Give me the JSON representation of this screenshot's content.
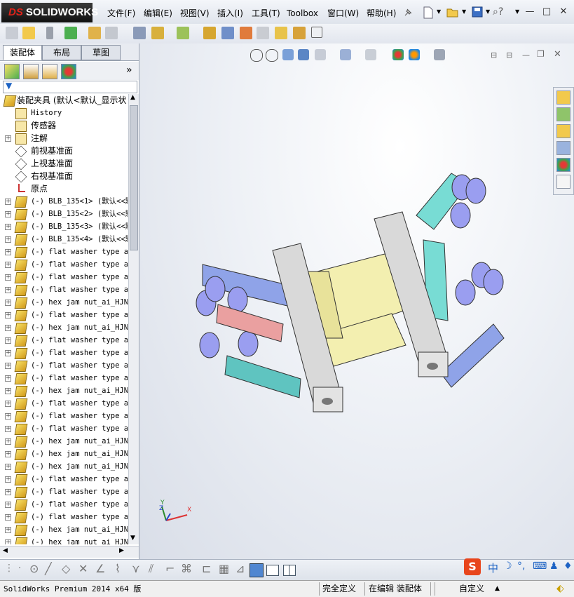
{
  "app": {
    "logo_prefix": "DS",
    "logo_text": "SOLIDWORKS"
  },
  "menu": [
    "文件(F)",
    "编辑(E)",
    "视图(V)",
    "插入(I)",
    "工具(T)",
    "Toolbox",
    "窗口(W)",
    "帮助(H)"
  ],
  "tabs": [
    "装配体",
    "布局",
    "草图"
  ],
  "tree": {
    "root": "装配夹具  (默认<默认_显示状",
    "items": [
      {
        "label": "History",
        "icon": "history-icon",
        "expand": false,
        "mono": true
      },
      {
        "label": "传感器",
        "icon": "sensor-icon",
        "expand": false,
        "mono": false
      },
      {
        "label": "注解",
        "icon": "annotation-icon",
        "expand": true,
        "mono": false
      },
      {
        "label": "前视基准面",
        "icon": "plane-icon",
        "expand": false,
        "mono": false
      },
      {
        "label": "上视基准面",
        "icon": "plane-icon",
        "expand": false,
        "mono": false
      },
      {
        "label": "右视基准面",
        "icon": "plane-icon",
        "expand": false,
        "mono": false
      },
      {
        "label": "原点",
        "icon": "origin-icon",
        "expand": false,
        "mono": false
      },
      {
        "label": "(-) BLB_135<1> (默认<<默",
        "icon": "part-icon",
        "expand": true,
        "mono": true
      },
      {
        "label": "(-) BLB_135<2> (默认<<默",
        "icon": "part-icon",
        "expand": true,
        "mono": true
      },
      {
        "label": "(-) BLB_135<3> (默认<<默",
        "icon": "part-icon",
        "expand": true,
        "mono": true
      },
      {
        "label": "(-) BLB_135<4> (默认<<默",
        "icon": "part-icon",
        "expand": true,
        "mono": true
      },
      {
        "label": "(-) flat washer type a",
        "icon": "part-icon",
        "expand": true,
        "mono": true
      },
      {
        "label": "(-) flat washer type a",
        "icon": "part-icon",
        "expand": true,
        "mono": true
      },
      {
        "label": "(-) flat washer type a",
        "icon": "part-icon",
        "expand": true,
        "mono": true
      },
      {
        "label": "(-) flat washer type a",
        "icon": "part-icon",
        "expand": true,
        "mono": true
      },
      {
        "label": "(-) hex jam nut_ai_HJNU",
        "icon": "part-icon",
        "expand": true,
        "mono": true
      },
      {
        "label": "(-) flat washer type a",
        "icon": "part-icon",
        "expand": true,
        "mono": true
      },
      {
        "label": "(-) hex jam nut_ai_HJNU",
        "icon": "part-icon",
        "expand": true,
        "mono": true
      },
      {
        "label": "(-) flat washer type a",
        "icon": "part-icon",
        "expand": true,
        "mono": true
      },
      {
        "label": "(-) flat washer type a",
        "icon": "part-icon",
        "expand": true,
        "mono": true
      },
      {
        "label": "(-) flat washer type a",
        "icon": "part-icon",
        "expand": true,
        "mono": true
      },
      {
        "label": "(-) flat washer type a",
        "icon": "part-icon",
        "expand": true,
        "mono": true
      },
      {
        "label": "(-) hex jam nut_ai_HJNU",
        "icon": "part-icon",
        "expand": true,
        "mono": true
      },
      {
        "label": "(-) flat washer type a",
        "icon": "part-icon",
        "expand": true,
        "mono": true
      },
      {
        "label": "(-) flat washer type a",
        "icon": "part-icon",
        "expand": true,
        "mono": true
      },
      {
        "label": "(-) flat washer type a",
        "icon": "part-icon",
        "expand": true,
        "mono": true
      },
      {
        "label": "(-) hex jam nut_ai_HJNU",
        "icon": "part-icon",
        "expand": true,
        "mono": true
      },
      {
        "label": "(-) hex jam nut_ai_HJNU",
        "icon": "part-icon",
        "expand": true,
        "mono": true
      },
      {
        "label": "(-) hex jam nut_ai_HJNU",
        "icon": "part-icon",
        "expand": true,
        "mono": true
      },
      {
        "label": "(-) flat washer type a",
        "icon": "part-icon",
        "expand": true,
        "mono": true
      },
      {
        "label": "(-) flat washer type a",
        "icon": "part-icon",
        "expand": true,
        "mono": true
      },
      {
        "label": "(-) flat washer type a",
        "icon": "part-icon",
        "expand": true,
        "mono": true
      },
      {
        "label": "(-) flat washer type a",
        "icon": "part-icon",
        "expand": true,
        "mono": true
      },
      {
        "label": "(-) hex jam nut_ai_HJNU",
        "icon": "part-icon",
        "expand": true,
        "mono": true
      },
      {
        "label": "(-) hex jam nut_ai_HJNU",
        "icon": "part-icon",
        "expand": true,
        "mono": true
      }
    ]
  },
  "triad": {
    "x": "X",
    "y": "Y",
    "z": "Z"
  },
  "status": {
    "product": "SolidWorks Premium 2014 x64 版",
    "defined": "完全定义",
    "editing": "在编辑 装配体",
    "units": "自定义",
    "units_arrow": "▲"
  },
  "ime": {
    "mark": "S",
    "lang": "中"
  },
  "colors": {
    "accent": "#e2231a",
    "link_blue": "#1e63c4"
  }
}
